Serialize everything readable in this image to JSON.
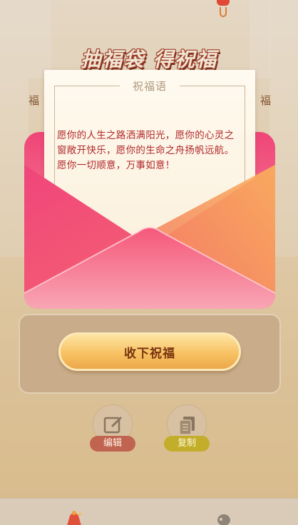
{
  "page": {
    "title": "抽福袋 得祝福",
    "side_left": "福",
    "side_right": "福"
  },
  "letter": {
    "heading": "祝福语",
    "message": "愿你的人生之路洒满阳光，愿你的心灵之窗敞开快乐，愿你的生命之舟扬帆远航。愿你一切顺意，万事如意！"
  },
  "actions": {
    "accept_label": "收下祝福",
    "edit_label": "编辑",
    "copy_label": "复制"
  },
  "tabbar": {
    "items": [
      {
        "icon": "lucky-bag-icon"
      },
      {
        "icon": "message-icon"
      }
    ]
  },
  "colors": {
    "accent": "#f7c263",
    "letter_text": "#b0292c",
    "edit_badge": "#c0644f",
    "copy_badge": "#c2ae2a"
  }
}
